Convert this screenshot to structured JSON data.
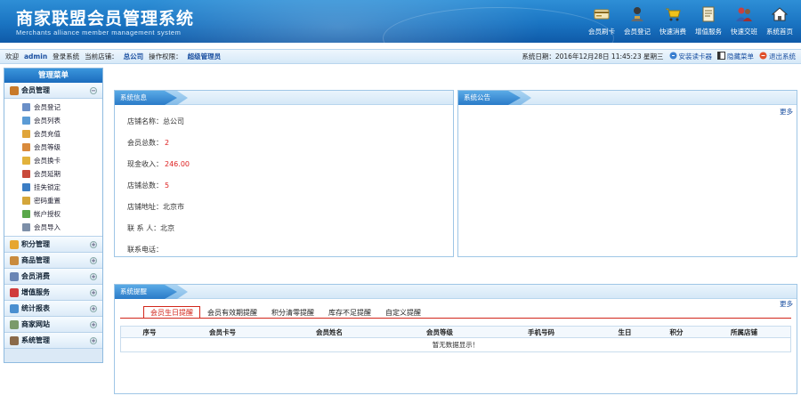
{
  "header": {
    "title": "商家联盟会员管理系统",
    "subtitle": "Merchants alliance member management system",
    "nav": [
      {
        "label": "会员刷卡",
        "icon": "card-icon"
      },
      {
        "label": "会员登记",
        "icon": "user-register-icon"
      },
      {
        "label": "快速消费",
        "icon": "cart-icon"
      },
      {
        "label": "增值服务",
        "icon": "book-icon"
      },
      {
        "label": "快速交班",
        "icon": "users-icon"
      },
      {
        "label": "系统首页",
        "icon": "home-icon"
      }
    ]
  },
  "status": {
    "welcome": "欢迎",
    "username": "admin",
    "login_text": "登录系统",
    "store_label": "当前店铺：",
    "store_name": "总公司",
    "perm_label": "操作权限：",
    "perm_value": "超级管理员",
    "date_text": "系统日期：2016年12月28日 11:45:23 星期三",
    "links": [
      {
        "label": "安装读卡器",
        "icon": "card-reader-icon"
      },
      {
        "label": "隐藏菜单",
        "icon": "hide-menu-icon"
      },
      {
        "label": "退出系统",
        "icon": "logout-icon"
      }
    ]
  },
  "sidebar": {
    "title": "管理菜单",
    "groups": [
      {
        "label": "会员管理",
        "toggle": "−",
        "color": "#c87a2a",
        "items": [
          {
            "label": "会员登记",
            "color": "#6a8fc7"
          },
          {
            "label": "会员列表",
            "color": "#5b9bd5"
          },
          {
            "label": "会员充值",
            "color": "#e0a53a"
          },
          {
            "label": "会员等级",
            "color": "#d98a3c"
          },
          {
            "label": "会员换卡",
            "color": "#e2b23b"
          },
          {
            "label": "会员延期",
            "color": "#c94a3a"
          },
          {
            "label": "挂失锁定",
            "color": "#3b7dc4"
          },
          {
            "label": "密码重置",
            "color": "#d4a63a"
          },
          {
            "label": "帐户授权",
            "color": "#5aa84a"
          },
          {
            "label": "会员导入",
            "color": "#7d8fa8"
          }
        ]
      },
      {
        "label": "积分管理",
        "toggle": "+",
        "color": "#e6a630"
      },
      {
        "label": "商品管理",
        "toggle": "+",
        "color": "#c98b3d"
      },
      {
        "label": "会员消费",
        "toggle": "+",
        "color": "#6a86b5"
      },
      {
        "label": "增值服务",
        "toggle": "+",
        "color": "#d03c3c"
      },
      {
        "label": "统计报表",
        "toggle": "+",
        "color": "#4a8fd0"
      },
      {
        "label": "商家网站",
        "toggle": "+",
        "color": "#7a9a6a"
      },
      {
        "label": "系统管理",
        "toggle": "+",
        "color": "#8a6a4a"
      }
    ]
  },
  "system_info": {
    "title": "系统信息",
    "rows": [
      {
        "label": "店铺名称：",
        "value": "总公司",
        "red": false
      },
      {
        "label": "会员总数：",
        "value": "2",
        "red": true
      },
      {
        "label": "现金收入：",
        "value": "246.00",
        "red": true
      },
      {
        "label": "店铺总数：",
        "value": "5",
        "red": true
      },
      {
        "label": "店铺地址：",
        "value": "北京市",
        "red": false
      },
      {
        "label": "联 系 人：",
        "value": "北京",
        "red": false
      },
      {
        "label": "联系电话：",
        "value": "",
        "red": false
      }
    ]
  },
  "announcement": {
    "title": "系统公告",
    "more": "更多"
  },
  "reminder": {
    "title": "系统提醒",
    "more": "更多",
    "tabs": [
      "会员生日提醒",
      "会员有效期提醒",
      "积分清零提醒",
      "库存不足提醒",
      "自定义提醒"
    ],
    "columns": [
      "序号",
      "会员卡号",
      "会员姓名",
      "会员等级",
      "手机号码",
      "生日",
      "积分",
      "所属店铺"
    ],
    "empty_text": "暂无数据显示！"
  }
}
